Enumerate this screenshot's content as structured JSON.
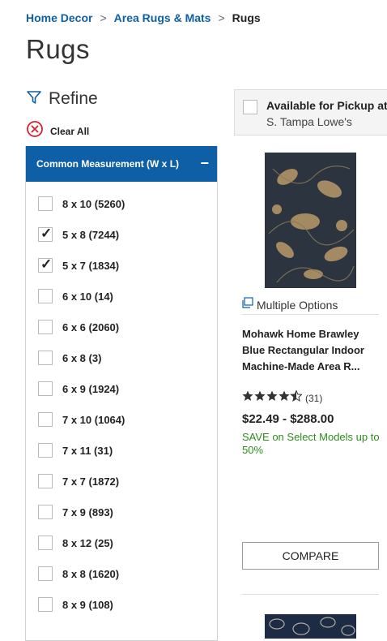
{
  "breadcrumb": {
    "items": [
      "Home Decor",
      "Area Rugs & Mats"
    ],
    "current": "Rugs",
    "separator": ">"
  },
  "page": {
    "title": "Rugs"
  },
  "refine": {
    "label": "Refine",
    "clear_all": "Clear All"
  },
  "facet": {
    "title": "Common Measurement (W x L)",
    "collapse_symbol": "−",
    "options": [
      {
        "label": "8 x 10 (5260)",
        "checked": false
      },
      {
        "label": "5 x 8 (7244)",
        "checked": true
      },
      {
        "label": "5 x 7 (1834)",
        "checked": true
      },
      {
        "label": "6 x 10 (14)",
        "checked": false
      },
      {
        "label": "6 x 6 (2060)",
        "checked": false
      },
      {
        "label": "6 x 8 (3)",
        "checked": false
      },
      {
        "label": "6 x 9 (1924)",
        "checked": false
      },
      {
        "label": "7 x 10 (1064)",
        "checked": false
      },
      {
        "label": "7 x 11 (31)",
        "checked": false
      },
      {
        "label": "7 x 7 (1872)",
        "checked": false
      },
      {
        "label": "7 x 9 (893)",
        "checked": false
      },
      {
        "label": "8 x 12 (25)",
        "checked": false
      },
      {
        "label": "8 x 8 (1620)",
        "checked": false
      },
      {
        "label": "8 x 9 (108)",
        "checked": false
      }
    ]
  },
  "pickup": {
    "label": "Available for Pickup at",
    "store": "S. Tampa Lowe's",
    "checked": false
  },
  "product": {
    "multiple_options": "Multiple Options",
    "name": "Mohawk Home Brawley Blue Rectangular Indoor Machine-Made Area R...",
    "rating": 4.5,
    "review_count": "(31)",
    "price": "$22.49 - $288.00",
    "promo": "SAVE on Select Models up to 50%",
    "compare_label": "COMPARE"
  },
  "colors": {
    "link": "#0f5fa6",
    "facet_header": "#0f5fa6",
    "clear_icon": "#d9202e",
    "promo": "#2e8b1e"
  }
}
